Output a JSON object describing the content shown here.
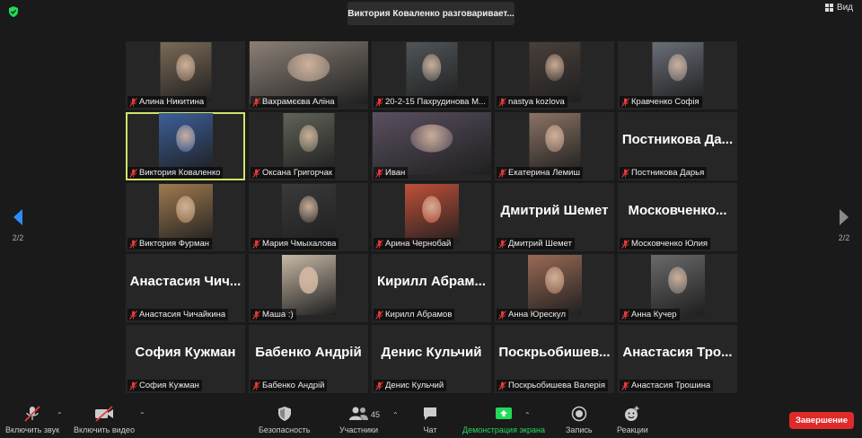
{
  "header": {
    "active_speaker": "Виктория Коваленко разговаривает...",
    "view_label": "Вид"
  },
  "pager": {
    "left": "2/2",
    "right": "2/2"
  },
  "participants": [
    {
      "name": "Алина Никитина",
      "video": "sm",
      "color": "#7a6a58"
    },
    {
      "name": "Вахрамєєва Аліна",
      "video": "lg",
      "color": "#8b8077"
    },
    {
      "name": "20-2-15 Пахрудинова М...",
      "video": "sm",
      "color": "#505558"
    },
    {
      "name": "nastya kozlova",
      "video": "sm",
      "color": "#4a3f3a"
    },
    {
      "name": "Кравченко Софія",
      "video": "sm",
      "color": "#6a6e78"
    },
    {
      "name": "Виктория Коваленко",
      "video": "md",
      "color": "#3b5f9a",
      "active": true
    },
    {
      "name": "Оксана Григорчак",
      "video": "sm",
      "color": "#606358"
    },
    {
      "name": "Иван",
      "video": "wide",
      "color": "#5a5060"
    },
    {
      "name": "Екатерина Лемиш",
      "video": "sm",
      "color": "#8c7365"
    },
    {
      "big": "Постникова  Да...",
      "name": "Постникова Дарья"
    },
    {
      "name": "Виктория Фурман",
      "video": "md",
      "color": "#a07a50"
    },
    {
      "name": "Мария Чмыхалова",
      "video": "md",
      "color": "#3a3a3a"
    },
    {
      "name": "Арина Чернобай",
      "video": "md",
      "color": "#c0503a"
    },
    {
      "big": "Дмитрий Шемет",
      "name": "Дмитрий Шемет"
    },
    {
      "big": "Московченко...",
      "name": "Московченко Юлия"
    },
    {
      "big": "Анастасия  Чич...",
      "name": "Анастасия Чичайкина"
    },
    {
      "name": "Маша :)",
      "video": "md",
      "color": "#c8b9a6"
    },
    {
      "big": "Кирилл  Абрам...",
      "name": "Кирилл Абрамов"
    },
    {
      "name": "Анна Юрескул",
      "video": "md",
      "color": "#9a6a55"
    },
    {
      "name": "Анна Кучер",
      "video": "md",
      "color": "#6a6a6a"
    },
    {
      "big": "София Кужман",
      "name": "София Кужман"
    },
    {
      "big": "Бабенко Андрій",
      "name": "Бабенко Андрій"
    },
    {
      "big": "Денис Кульчий",
      "name": "Денис Кульчий"
    },
    {
      "big": "Поскрьобишев...",
      "name": "Поскрьобишева Валерія"
    },
    {
      "big": "Анастасия  Тро...",
      "name": "Анастасия Трошина"
    }
  ],
  "toolbar": {
    "unmute": "Включить звук",
    "start_video": "Включить видео",
    "security": "Безопасность",
    "participants": "Участники",
    "participants_count": "45",
    "chat": "Чат",
    "share": "Демонстрация экрана",
    "record": "Запись",
    "reactions": "Реакции",
    "end": "Завершение"
  },
  "colors": {
    "background": "#1a1a1a",
    "tile": "#262626",
    "active_border": "#cfe36a",
    "share_green": "#23d959",
    "end_red": "#e02a2a",
    "mute_red": "#e53b3b",
    "pager_blue": "#2d8cff"
  }
}
